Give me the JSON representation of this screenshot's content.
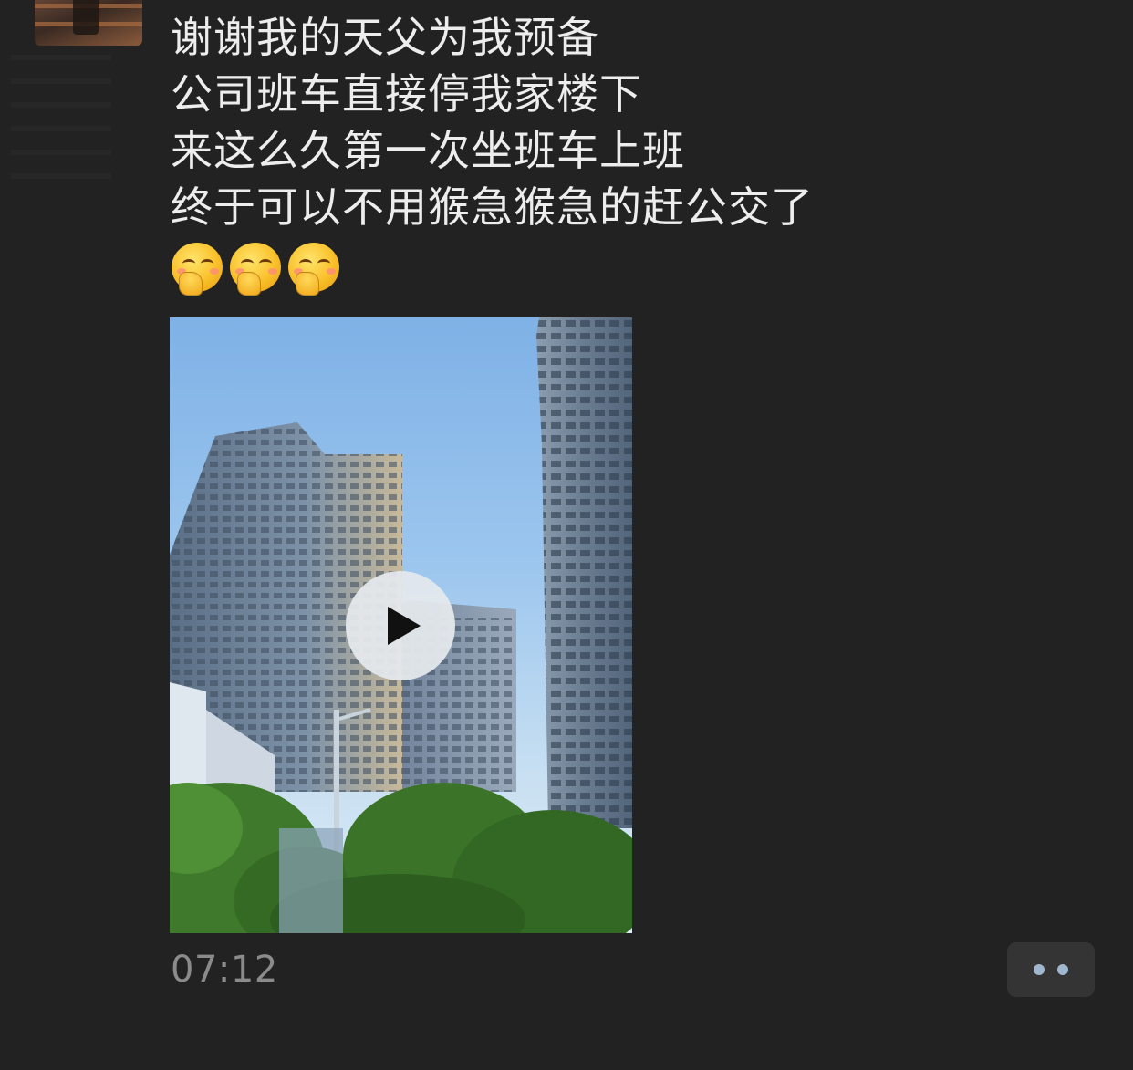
{
  "post": {
    "lines": [
      "谢谢我的天父为我预备",
      "公司班车直接停我家楼下",
      "来这么久第一次坐班车上班",
      "终于可以不用猴急猴急的赶公交了"
    ],
    "emojis": [
      "face-with-hand-over-mouth-icon",
      "face-with-hand-over-mouth-icon",
      "face-with-hand-over-mouth-icon"
    ],
    "timestamp": "07:12"
  },
  "colors": {
    "background": "#222222",
    "text": "#ededed",
    "timestamp": "#8b8b8b",
    "more_button_bg": "#343434",
    "more_button_dots": "#9fb6cf"
  }
}
